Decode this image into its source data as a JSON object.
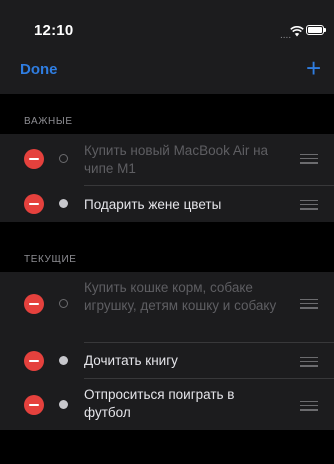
{
  "status_bar": {
    "time": "12:10",
    "dots": "...."
  },
  "nav": {
    "done_label": "Done",
    "add_symbol": "+"
  },
  "sections": [
    {
      "title": "ВАЖНЫЕ",
      "items": [
        {
          "text": "Купить новый MacBook Air на чипе M1",
          "done": false
        },
        {
          "text": "Подарить жене цветы",
          "done": true
        }
      ]
    },
    {
      "title": "ТЕКУЩИЕ",
      "items": [
        {
          "text": "Купить кошке корм, собаке игрушку, детям кошку и собаку",
          "done": false
        },
        {
          "text": "Дочитать книгу",
          "done": true
        },
        {
          "text": "Отпроситься поиграть в футбол",
          "done": true
        }
      ]
    }
  ],
  "colors": {
    "accent": "#2f7de1",
    "delete": "#e5413d",
    "background": "#000000",
    "cell": "#1c1c1e"
  }
}
